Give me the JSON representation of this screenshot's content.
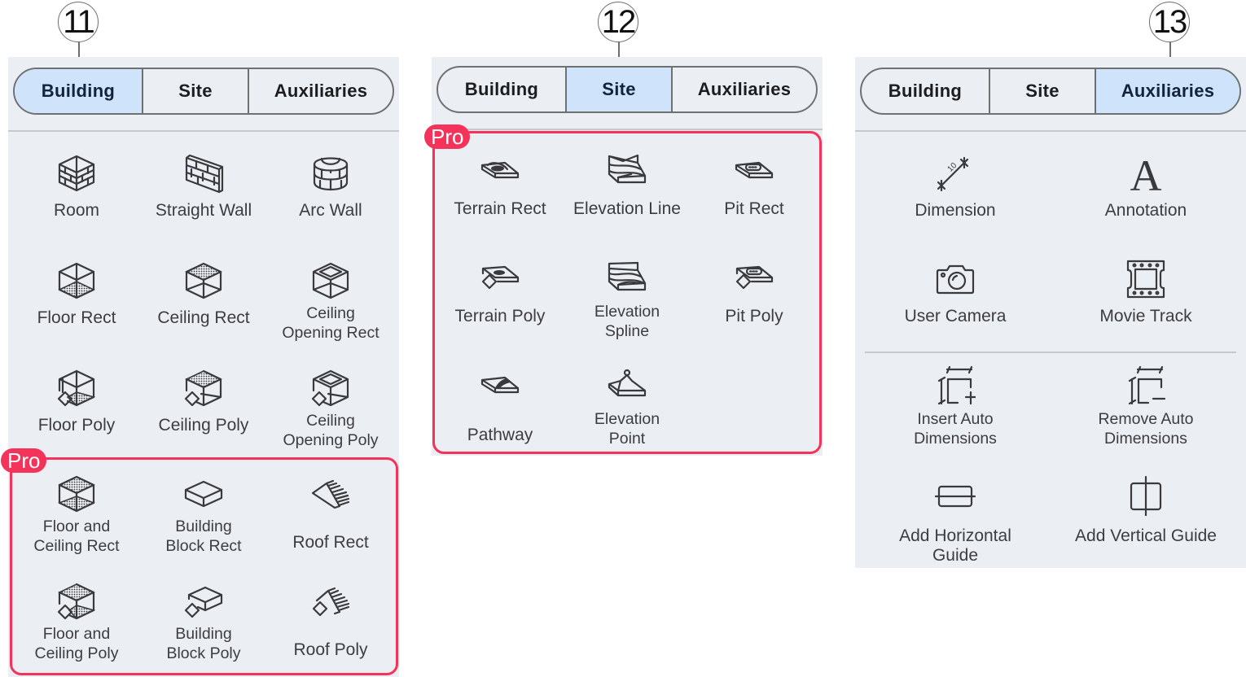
{
  "callouts": [
    "11",
    "12",
    "13"
  ],
  "colors": {
    "active_tab": "#cfe4fb",
    "pro_accent": "#f5325a",
    "panel_bg": "#ebeef3"
  },
  "panels": [
    {
      "tabs": [
        {
          "label": "Building",
          "active": true
        },
        {
          "label": "Site",
          "active": false
        },
        {
          "label": "Auxiliaries",
          "active": false
        }
      ],
      "items": [
        {
          "label": "Room",
          "icon": "room-icon"
        },
        {
          "label": "Straight Wall",
          "icon": "straight-wall-icon"
        },
        {
          "label": "Arc Wall",
          "icon": "arc-wall-icon"
        },
        {
          "label": "Floor Rect",
          "icon": "floor-rect-icon"
        },
        {
          "label": "Ceiling Rect",
          "icon": "ceiling-rect-icon"
        },
        {
          "label": "Ceiling\nOpening Rect",
          "icon": "ceiling-opening-rect-icon"
        },
        {
          "label": "Floor Poly",
          "icon": "floor-poly-icon"
        },
        {
          "label": "Ceiling Poly",
          "icon": "ceiling-poly-icon"
        },
        {
          "label": "Ceiling\nOpening Poly",
          "icon": "ceiling-opening-poly-icon"
        }
      ],
      "pro_label": "Pro",
      "pro_items": [
        {
          "label": "Floor and\nCeiling Rect",
          "icon": "floor-ceiling-rect-icon"
        },
        {
          "label": "Building\nBlock Rect",
          "icon": "building-block-rect-icon"
        },
        {
          "label": "Roof Rect",
          "icon": "roof-rect-icon"
        },
        {
          "label": "Floor and\nCeiling Poly",
          "icon": "floor-ceiling-poly-icon"
        },
        {
          "label": "Building\nBlock Poly",
          "icon": "building-block-poly-icon"
        },
        {
          "label": "Roof Poly",
          "icon": "roof-poly-icon"
        }
      ]
    },
    {
      "tabs": [
        {
          "label": "Building",
          "active": false
        },
        {
          "label": "Site",
          "active": true
        },
        {
          "label": "Auxiliaries",
          "active": false
        }
      ],
      "pro_label": "Pro",
      "pro_items": [
        {
          "label": "Terrain Rect",
          "icon": "terrain-rect-icon"
        },
        {
          "label": "Elevation Line",
          "icon": "elevation-line-icon"
        },
        {
          "label": "Pit Rect",
          "icon": "pit-rect-icon"
        },
        {
          "label": "Terrain Poly",
          "icon": "terrain-poly-icon"
        },
        {
          "label": "Elevation\nSpline",
          "icon": "elevation-spline-icon"
        },
        {
          "label": "Pit Poly",
          "icon": "pit-poly-icon"
        },
        {
          "label": "Pathway",
          "icon": "pathway-icon"
        },
        {
          "label": "Elevation\nPoint",
          "icon": "elevation-point-icon"
        }
      ]
    },
    {
      "tabs": [
        {
          "label": "Building",
          "active": false
        },
        {
          "label": "Site",
          "active": false
        },
        {
          "label": "Auxiliaries",
          "active": true
        }
      ],
      "items": [
        {
          "label": "Dimension",
          "icon": "dimension-icon"
        },
        {
          "label": "Annotation",
          "icon": "annotation-icon"
        },
        {
          "label": "User Camera",
          "icon": "camera-icon"
        },
        {
          "label": "Movie Track",
          "icon": "film-icon"
        },
        {
          "label": "Insert Auto\nDimensions",
          "icon": "insert-auto-dimensions-icon"
        },
        {
          "label": "Remove Auto\nDimensions",
          "icon": "remove-auto-dimensions-icon"
        },
        {
          "label": "Add Horizontal Guide",
          "icon": "horizontal-guide-icon"
        },
        {
          "label": "Add Vertical Guide",
          "icon": "vertical-guide-icon"
        }
      ],
      "dimension_text": "10",
      "annotation_glyph": "A"
    }
  ]
}
